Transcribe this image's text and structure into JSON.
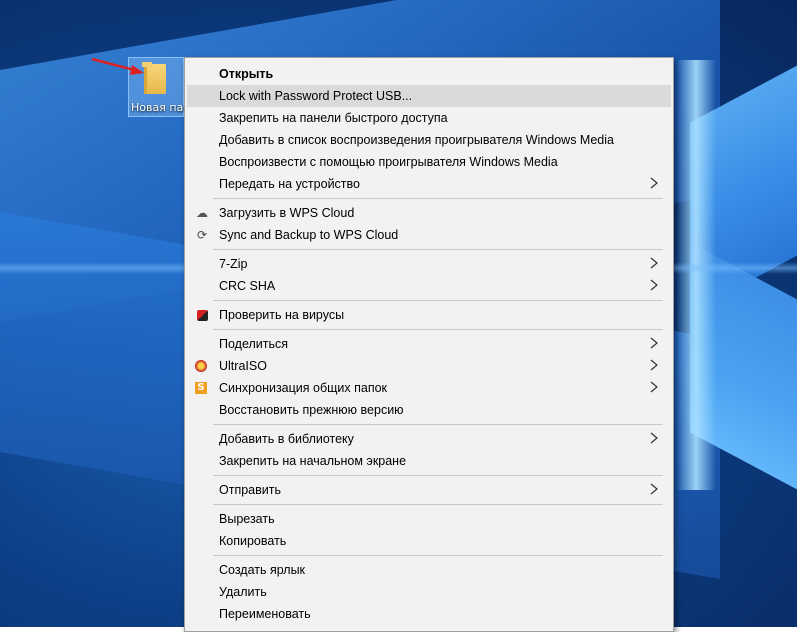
{
  "desktop": {
    "folder_label": "Новая папка"
  },
  "menu": {
    "items": [
      {
        "label": "Открыть",
        "bold": true
      },
      {
        "label": "Lock with Password Protect USB...",
        "highlighted": true
      },
      {
        "label": "Закрепить на панели быстрого доступа"
      },
      {
        "label": "Добавить в список воспроизведения проигрывателя Windows Media"
      },
      {
        "label": "Воспроизвести с помощью проигрывателя Windows Media"
      },
      {
        "label": "Передать на устройство",
        "submenu": true
      },
      {
        "label": "Загрузить в WPS Cloud",
        "icon": "cloud-icon"
      },
      {
        "label": "Sync and Backup to WPS Cloud",
        "icon": "sync-icon"
      },
      {
        "label": "7-Zip",
        "submenu": true
      },
      {
        "label": "CRC SHA",
        "submenu": true
      },
      {
        "label": "Проверить на вирусы",
        "icon": "antivirus-icon"
      },
      {
        "label": "Поделиться",
        "submenu": true
      },
      {
        "label": "UltraISO",
        "icon": "ultraiso-icon",
        "submenu": true
      },
      {
        "label": "Синхронизация общих папок",
        "icon": "shared-sync-icon",
        "submenu": true
      },
      {
        "label": "Восстановить прежнюю версию"
      },
      {
        "label": "Добавить в библиотеку",
        "submenu": true
      },
      {
        "label": "Закрепить на начальном экране"
      },
      {
        "label": "Отправить",
        "submenu": true
      },
      {
        "label": "Вырезать"
      },
      {
        "label": "Копировать"
      },
      {
        "label": "Создать ярлык"
      },
      {
        "label": "Удалить"
      },
      {
        "label": "Переименовать"
      }
    ]
  },
  "colors": {
    "menu_bg": "#f2f2f2",
    "highlight": "#dadada",
    "annotation_arrow": "#e02020",
    "desktop_blue": "#0d3f86"
  }
}
